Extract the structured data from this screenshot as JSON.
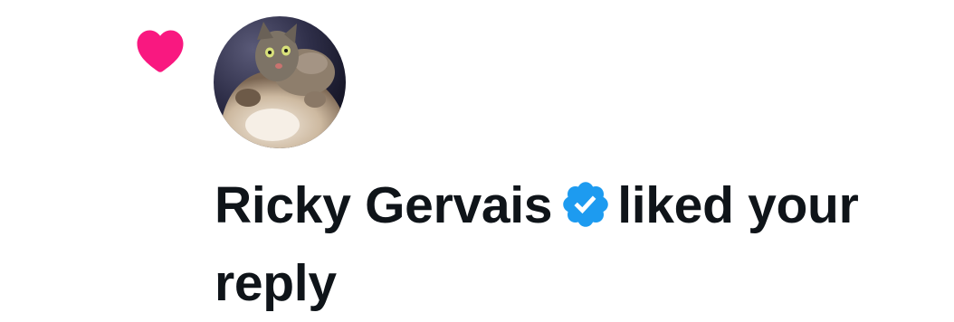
{
  "notification": {
    "type_icon": "heart-icon",
    "like_color": "#f91880",
    "avatar_subject": "cat-photo",
    "actor_name": "Ricky Gervais",
    "verified": true,
    "verified_badge_color": "#1d9bf0",
    "action_text": "liked your reply"
  }
}
